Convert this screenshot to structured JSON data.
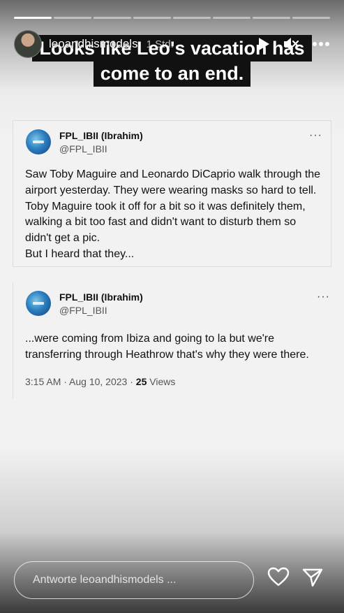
{
  "story": {
    "segments_total": 8,
    "segments_done": 1,
    "caption_line1": "Looks like Leo's vacation has",
    "caption_line2": "come to an end.",
    "username": "leoandhismodels",
    "time": "1 Std."
  },
  "icons": {
    "play": "play-icon",
    "mute": "speaker-muted-icon",
    "more": "more-dots-icon",
    "like": "heart-icon",
    "share": "send-icon"
  },
  "tweets": [
    {
      "name": "FPL_IBII (Ibrahim)",
      "handle": "@FPL_IBII",
      "more": "···",
      "lines": [
        "Saw Toby Maguire and Leonardo DiCaprio walk through the",
        "airport yesterday. They were wearing masks so hard to tell.",
        "Toby Maguire took it off for a bit so it was definitely them,",
        "walking a bit too fast and didn't want to disturb them so",
        "didn't get a pic.",
        "But I heard that they..."
      ]
    },
    {
      "name": "FPL_IBII (Ibrahim)",
      "handle": "@FPL_IBII",
      "more": "···",
      "lines": [
        "...were coming from Ibiza and going to la but we're",
        "transferring through Heathrow that's why they were there."
      ],
      "timestamp": "3:15 AM · Aug 10, 2023 · ",
      "views_count": "25",
      "views_label": " Views"
    }
  ],
  "reply": {
    "placeholder": "Antworte leoandhismodels ..."
  }
}
